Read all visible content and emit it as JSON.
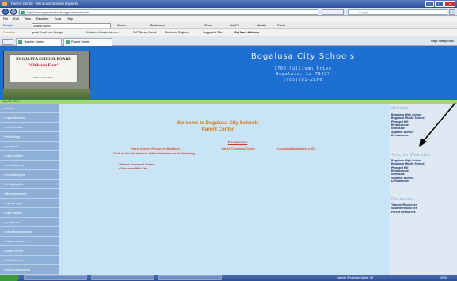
{
  "window": {
    "title": "Parent Center - Windows Internet Explorer"
  },
  "address": {
    "url": "http://www.bogalusaschools.org/parentcenter.htm",
    "search": "Google"
  },
  "menu": [
    "File",
    "Edit",
    "View",
    "Favorites",
    "Tools",
    "Help"
  ],
  "googlebar": {
    "label": "Google",
    "query": "Acadia Parish",
    "items": [
      "Search",
      "Bookmarks",
      "Check",
      "AutoFill",
      "Acadia",
      "Parish"
    ]
  },
  "favbar": {
    "items": [
      "Favorites",
      "gmail Email from Google",
      "Division of Leadership an...",
      "SLP Survey Portal",
      "Electronic Register",
      "Suggested Sites",
      "Get More Add-ons"
    ]
  },
  "tabs": [
    "Teacher Center",
    "Parent Center"
  ],
  "cmd": "Page  Safety  Tools",
  "site": {
    "title": "Bogalusa City Schools",
    "address1": "1700 Sullivan Drive",
    "address2": "Bogalusa, LA 70427",
    "phone": "(985)281-2100",
    "date": "July 26, 2009"
  },
  "logo": {
    "line1": "BOGALUSA SCHOOL BOARD",
    "line2": "\"Children First\"",
    "line3": "1700 Sullivan Drive"
  },
  "nav": [
    "home",
    "superintendent",
    "school board",
    "technology",
    "personnel",
    "child nutrition",
    "secondary ed",
    "elementary ed",
    "strategic plan",
    "title department",
    "finance dept",
    "child welfare",
    "special ed",
    "maint/transportation",
    "teacher center",
    "parent center",
    "student center",
    "school documents"
  ],
  "main": {
    "welcome1": "Welcome to Bogalusa City Schools",
    "welcome2": "Parent Center",
    "resources": "Resources",
    "brochure": "Parent Internet Resources Brochure",
    "command": "Parish Command Center",
    "doe": "Louisiana Department of Ed",
    "instructions": "Click on the link above to obtain directions for the following:",
    "bullet1": "Parent Command Center",
    "bullet2": "Outcomes Web Site"
  },
  "right": {
    "schools_head": "Schools",
    "schools": [
      "Bogalusa High School",
      "Bogalusa Middle School",
      "Pleasant Hill",
      "Byrd Avenue",
      "Northside",
      "Superior Avenue",
      "Denhamtown"
    ],
    "teacher_head": "Teacher Websites",
    "teachers": [
      "Bogalusa High School",
      "Bogalusa Middle School",
      "Pleasant Hill",
      "Byrd Avenue",
      "Northside",
      "Superior Avenue",
      "Denhamtown"
    ],
    "resources_head": "Resources",
    "resources": [
      "Teacher Resources",
      "Student Resources",
      "Parent Resources"
    ]
  },
  "status": {
    "zone": "Internet | Protected Mode: Off",
    "zoom": "100%"
  }
}
